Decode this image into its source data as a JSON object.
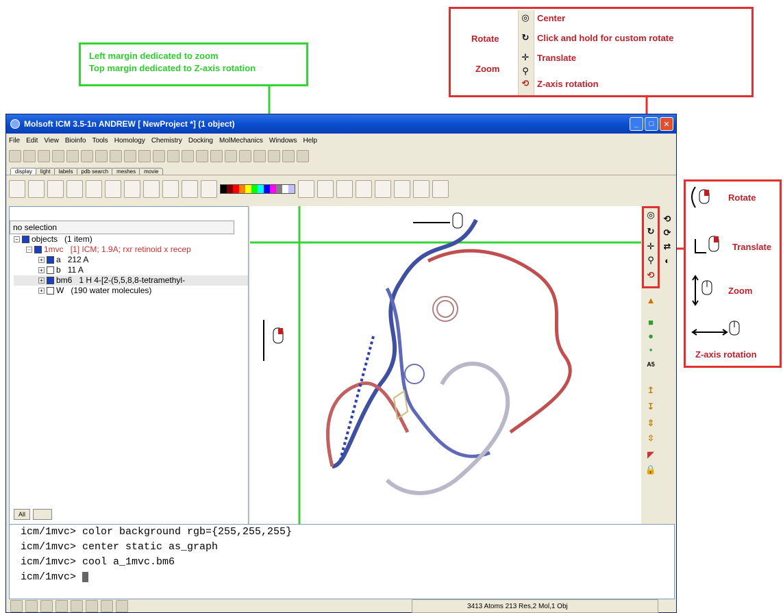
{
  "callouts": {
    "margins": {
      "line1": "Left margin dedicated to zoom",
      "line2": "Top margin dedicated to Z-axis rotation"
    },
    "toolbar_legend": {
      "side_rotate": "Rotate",
      "side_zoom": "Zoom",
      "items": [
        {
          "icon": "center-icon",
          "label": "Center"
        },
        {
          "icon": "rotate-icon",
          "label": "Click and hold for custom rotate"
        },
        {
          "icon": "translate-icon",
          "label": "Translate"
        },
        {
          "icon": "zoom-icon",
          "label": ""
        },
        {
          "icon": "z-axis-rotation-icon",
          "label": "Z-axis rotation"
        }
      ]
    },
    "mouse_legend": {
      "rotate": "Rotate",
      "translate": "Translate",
      "zoom": "Zoom",
      "z_axis_rotation": "Z-axis rotation"
    }
  },
  "window": {
    "title": "Molsoft ICM 3.5-1n ANDREW [ NewProject *] (1 object)",
    "menu": [
      "File",
      "Edit",
      "View",
      "Bioinfo",
      "Tools",
      "Homology",
      "Chemistry",
      "Docking",
      "MolMechanics",
      "Windows",
      "Help"
    ],
    "tabs": [
      "display",
      "light",
      "labels",
      "pdb search",
      "meshes",
      "movie"
    ],
    "active_tab": "display",
    "accent": "#0a4ed0"
  },
  "workspace": {
    "selection": "no selection",
    "tree": [
      {
        "name": "objects",
        "info": "(1 item)",
        "color": "#000000"
      },
      {
        "name": "1mvc",
        "info": "[1] ICM; 1.9A; rxr retinoid x recep",
        "color": "#d03030"
      },
      {
        "name": "a",
        "info": "212 A",
        "color": "#000000"
      },
      {
        "name": "b",
        "info": "11 A",
        "color": "#000000"
      },
      {
        "name": "bm6",
        "info": "1 H 4-[2-(5,5,8,8-tetramethyl-",
        "color": "#000000"
      },
      {
        "name": "W",
        "info": "(190 water molecules)",
        "color": "#000000"
      }
    ],
    "bottom_tab": "All"
  },
  "console": {
    "lines": [
      "icm/1mvc> color background rgb={255,255,255}",
      "icm/1mvc> center static as_graph",
      "icm/1mvc> cool a_1mvc.bm6",
      "icm/1mvc> "
    ]
  },
  "status": {
    "text": "3413 Atoms 213 Res,2 Mol,1 Obj"
  }
}
